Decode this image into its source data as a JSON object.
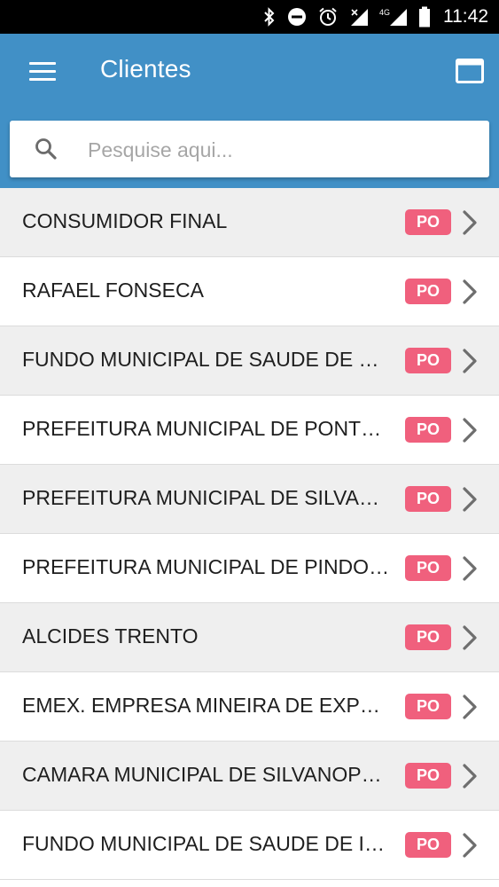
{
  "status_bar": {
    "time": "11:42",
    "icons": [
      "bluetooth-icon",
      "do-not-disturb-icon",
      "alarm-icon",
      "signal-icon",
      "4g-signal-icon",
      "battery-icon"
    ],
    "network_label": "4G"
  },
  "header": {
    "title": "Clientes",
    "menu_icon": "hamburger-menu-icon",
    "action_icon": "window-icon",
    "color": "#4190c6"
  },
  "search": {
    "placeholder": "Pesquise aqui...",
    "value": ""
  },
  "clients": [
    {
      "name": "CONSUMIDOR FINAL",
      "badge": "PO"
    },
    {
      "name": "RAFAEL FONSECA",
      "badge": "PO"
    },
    {
      "name": "FUNDO MUNICIPAL DE SAUDE DE SILVANOPOLIS",
      "badge": "PO"
    },
    {
      "name": "PREFEITURA MUNICIPAL DE PONTE ALTA",
      "badge": "PO"
    },
    {
      "name": "PREFEITURA MUNICIPAL DE SILVANOPOLIS",
      "badge": "PO"
    },
    {
      "name": "PREFEITURA MUNICIPAL DE PINDORAMA",
      "badge": "PO"
    },
    {
      "name": "ALCIDES TRENTO",
      "badge": "PO"
    },
    {
      "name": "EMEX. EMPRESA MINEIRA DE EXPLORACAO",
      "badge": "PO"
    },
    {
      "name": "CAMARA MUNICIPAL DE SILVANOPOLIS",
      "badge": "PO"
    },
    {
      "name": "FUNDO MUNICIPAL DE SAUDE DE IPUEIRAS",
      "badge": "PO"
    }
  ],
  "colors": {
    "badge": "#f0607d",
    "row_alt": "#efefef"
  }
}
